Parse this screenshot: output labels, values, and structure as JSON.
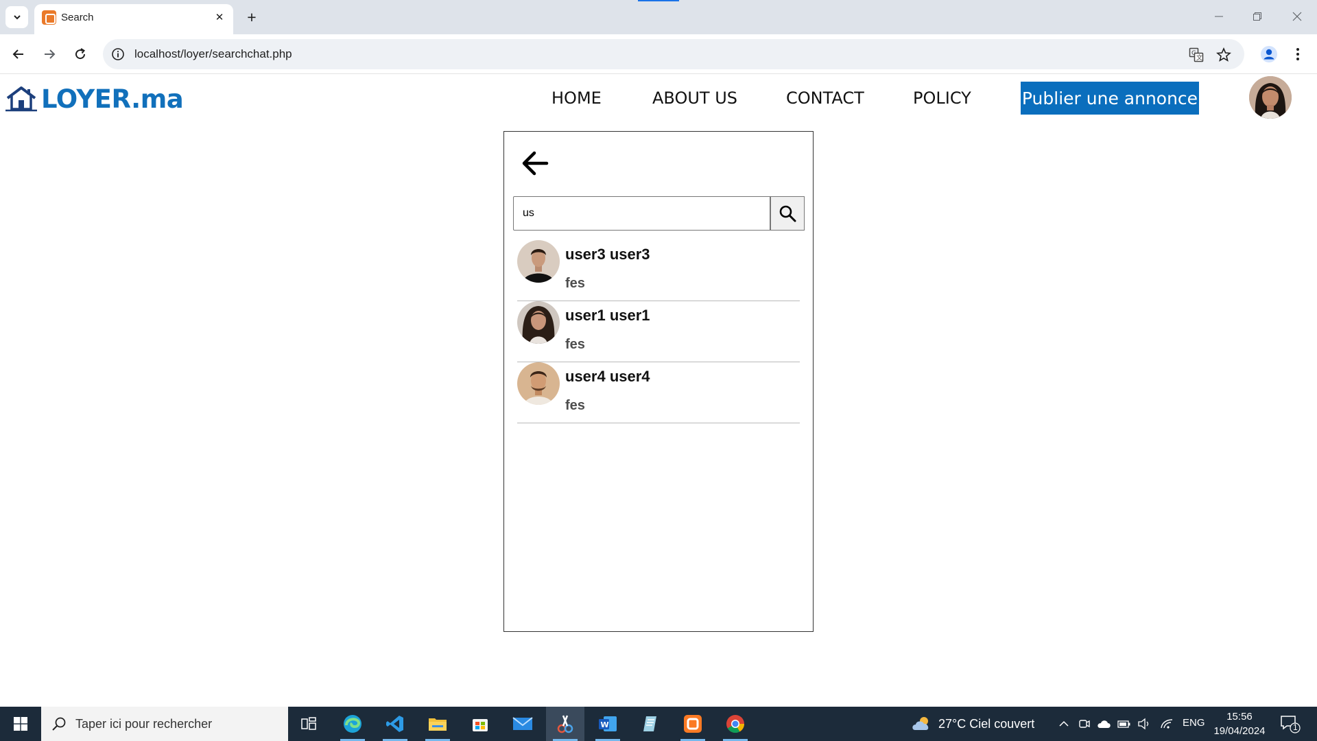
{
  "browser": {
    "tab_title": "Search",
    "url": "localhost/loyer/searchchat.php"
  },
  "site": {
    "logo_text": "LOYER.ma",
    "nav": [
      "HOME",
      "ABOUT US",
      "CONTACT",
      "POLICY"
    ],
    "publish_label": "Publier une annonce"
  },
  "search": {
    "query": "us"
  },
  "results": [
    {
      "name": "user3 user3",
      "city": "fes",
      "avatar": "male-avatar-dark-hoodie"
    },
    {
      "name": "user1 user1",
      "city": "fes",
      "avatar": "female-avatar-curly-hair"
    },
    {
      "name": "user4 user4",
      "city": "fes",
      "avatar": "male-avatar-beard"
    }
  ],
  "taskbar": {
    "search_placeholder": "Taper ici pour rechercher",
    "weather": "27°C  Ciel couvert",
    "lang": "ENG",
    "time": "15:56",
    "date": "19/04/2024",
    "notification_count": "1"
  },
  "colors": {
    "brand": "#1170bb",
    "publish_button": "#0a6ebd",
    "taskbar": "#1c2b3a"
  }
}
